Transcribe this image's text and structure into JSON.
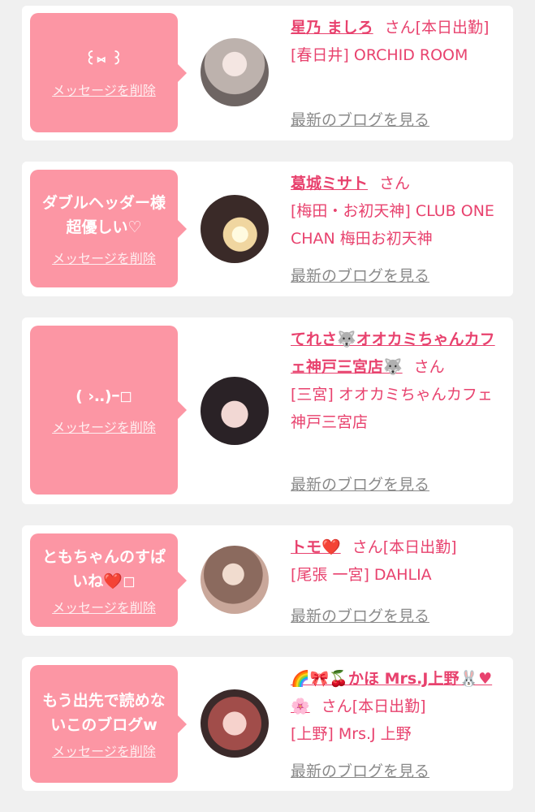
{
  "delete_label": "メッセージを削除",
  "blog_label": "最新のブログを見る",
  "san_label": "さん",
  "colors": {
    "bubble": "#fc96a4",
    "accent": "#e8426e",
    "muted": "#8a8a8a",
    "background": "#f0f0f0"
  },
  "entries": [
    {
      "message": "꒰⑅ ꒱",
      "name": "星乃 ましろ",
      "status": "[本日出勤]",
      "shop": "[春日井] ORCHID ROOM",
      "avatar": "avatar-1"
    },
    {
      "message": "ダブルヘッダー様超優しい♡",
      "name": "葛城ミサト",
      "status": "",
      "shop": "[梅田・お初天神] CLUB ONE CHAN 梅田お初天神",
      "avatar": "avatar-2"
    },
    {
      "message": "( ›‥)ｰ◻",
      "name": "てれさ🐺オオカミちゃんカフェ神戸三宮店🐺",
      "status": "",
      "shop": "[三宮] オオカミちゃんカフェ神戸三宮店",
      "avatar": "avatar-3"
    },
    {
      "message": "ともちゃんのすぱいね❤️◻",
      "name": "トモ❤️",
      "status": "[本日出勤]",
      "shop": "[尾張 一宮] DAHLIA",
      "avatar": "avatar-4"
    },
    {
      "message": "もう出先で読めないこのブログw",
      "name": "🌈🎀🍒かほ Mrs.J上野🐰♥🌸",
      "status": "[本日出勤]",
      "shop": "[上野] Mrs.J 上野",
      "avatar": "avatar-5"
    }
  ]
}
